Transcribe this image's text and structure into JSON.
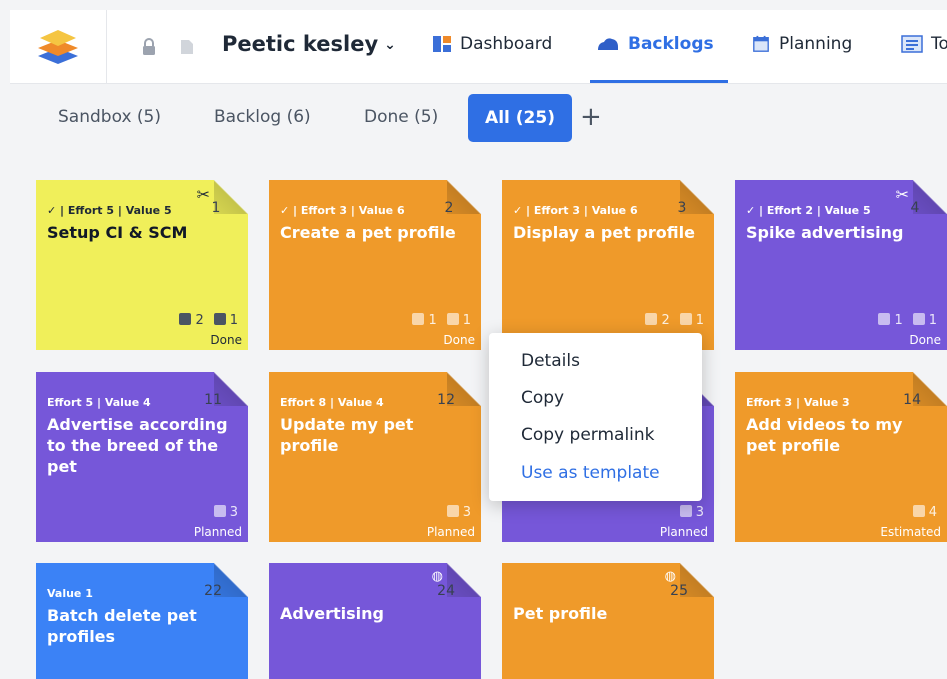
{
  "header": {
    "project_name": "Peetic kesley",
    "project_chevron": "⌄",
    "nav": [
      {
        "label": "Dashboard",
        "active": false
      },
      {
        "label": "Backlogs",
        "active": true
      },
      {
        "label": "Planning",
        "active": false
      },
      {
        "label": "To",
        "active": false
      }
    ]
  },
  "filters": {
    "tabs": [
      "Sandbox (5)",
      "Backlog (6)",
      "Done (5)"
    ],
    "active": "All (25)",
    "add": "+"
  },
  "colors": {
    "accent": "#2f6fe4",
    "yellow": "#f0ef5a",
    "orange": "#ef9a2a",
    "purple": "#7657d9",
    "blue": "#3b82f6"
  },
  "cards": [
    {
      "num": "1",
      "meta": "✓ | Effort 5 | Value 5",
      "title": "Setup CI & SCM",
      "checks": "2",
      "docs": "1",
      "status": "Done",
      "color": "yellow",
      "icon": "tools-icon"
    },
    {
      "num": "2",
      "meta": "✓ | Effort 3 | Value 6",
      "title": "Create a pet profile",
      "checks": "1",
      "docs": "1",
      "status": "Done",
      "color": "orange"
    },
    {
      "num": "3",
      "meta": "✓ | Effort 3 | Value 6",
      "title": "Display a pet profile",
      "checks": "2",
      "docs": "1",
      "status": "",
      "color": "orange"
    },
    {
      "num": "4",
      "meta": "✓ | Effort 2 | Value 5",
      "title": "Spike advertising",
      "checks": "1",
      "docs": "1",
      "status": "Done",
      "color": "purple",
      "icon": "tools-icon"
    },
    {
      "num": "11",
      "meta": "Effort 5 | Value 4",
      "title": "Advertise according to the breed of the pet",
      "docs": "3",
      "status": "Planned",
      "color": "purple"
    },
    {
      "num": "12",
      "meta": "Effort 8 | Value 4",
      "title": "Update my pet profile",
      "docs": "3",
      "status": "Planned",
      "color": "orange"
    },
    {
      "num": "",
      "meta": "",
      "title": "",
      "docs": "3",
      "status": "Planned",
      "color": "purple"
    },
    {
      "num": "14",
      "meta": "Effort 3 | Value 3",
      "title": "Add videos to my pet profile",
      "docs": "4",
      "status": "Estimated",
      "color": "orange"
    },
    {
      "num": "22",
      "meta": "Value 1",
      "title": "Batch delete pet profiles",
      "color": "blue"
    },
    {
      "num": "24",
      "meta": "",
      "title": "Advertising",
      "color": "purple",
      "icon": "globe-icon"
    },
    {
      "num": "25",
      "meta": "",
      "title": "Pet profile",
      "color": "orange",
      "icon": "globe-icon"
    }
  ],
  "context_menu": {
    "items": [
      "Details",
      "Copy",
      "Copy permalink"
    ],
    "link_item": "Use as template"
  }
}
